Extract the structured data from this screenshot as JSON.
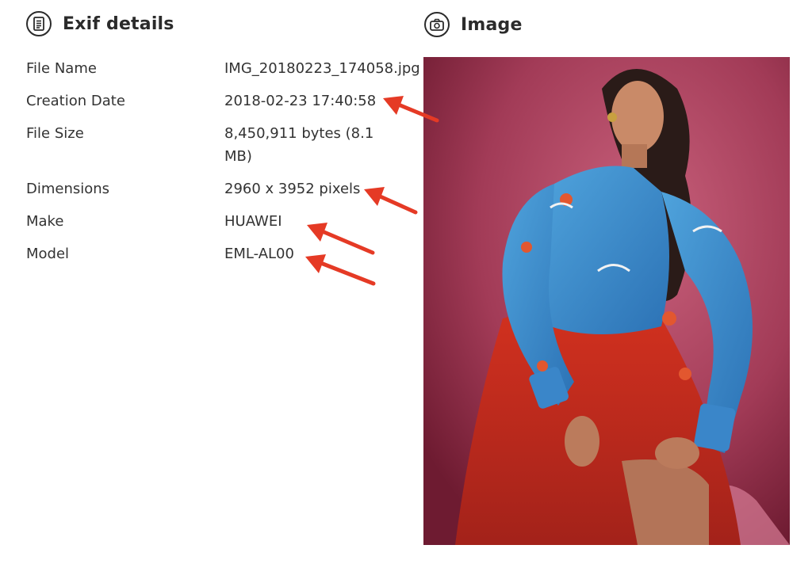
{
  "sections": {
    "exif_title": "Exif details",
    "image_title": "Image"
  },
  "icons": {
    "exif": "document-icon",
    "image": "camera-icon"
  },
  "exif": [
    {
      "label": "File Name",
      "value": "IMG_20180223_174058.jpg"
    },
    {
      "label": "Creation Date",
      "value": "2018-02-23 17:40:58"
    },
    {
      "label": "File Size",
      "value": "8,450,911 bytes (8.1 MB)"
    },
    {
      "label": "Dimensions",
      "value": "2960 x 3952 pixels"
    },
    {
      "label": "Make",
      "value": "HUAWEI"
    },
    {
      "label": "Model",
      "value": "EML-AL00"
    }
  ],
  "colors": {
    "annotation_arrow": "#e53a25",
    "text": "#333333",
    "heading": "#2b2b2b"
  }
}
